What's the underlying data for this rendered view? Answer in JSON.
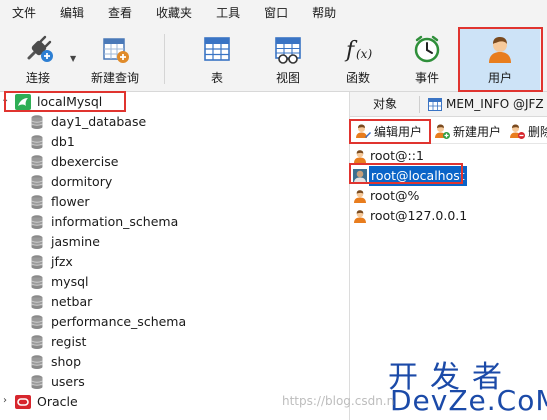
{
  "menubar": {
    "items": [
      "文件",
      "编辑",
      "查看",
      "收藏夹",
      "工具",
      "窗口",
      "帮助"
    ]
  },
  "toolbar": {
    "connect_label": "连接",
    "new_query_label": "新建查询",
    "table_label": "表",
    "view_label": "视图",
    "function_label": "函数",
    "event_label": "事件",
    "user_label": "用户"
  },
  "sidebar": {
    "connection": "localMysql",
    "databases": [
      "day1_database",
      "db1",
      "dbexercise",
      "dormitory",
      "flower",
      "information_schema",
      "jasmine",
      "jfzx",
      "mysql",
      "netbar",
      "performance_schema",
      "regist",
      "shop",
      "users"
    ],
    "other_connection": "Oracle"
  },
  "tabs": {
    "objects": "对象",
    "mem_info": "MEM_INFO @JFZ"
  },
  "user_toolbar": {
    "edit_user": "编辑用户",
    "new_user": "新建用户",
    "delete_user": "删除"
  },
  "users": [
    "root@::1",
    "root@localhost",
    "root@%",
    "root@127.0.0.1"
  ],
  "watermark": {
    "chinese": "开发者",
    "english": "DevZe.CoM",
    "url": "https://blog.csdn.n"
  },
  "colors": {
    "highlight_border": "#e0342f",
    "selection": "#0a64c8",
    "watermark": "#1b4aa8"
  }
}
